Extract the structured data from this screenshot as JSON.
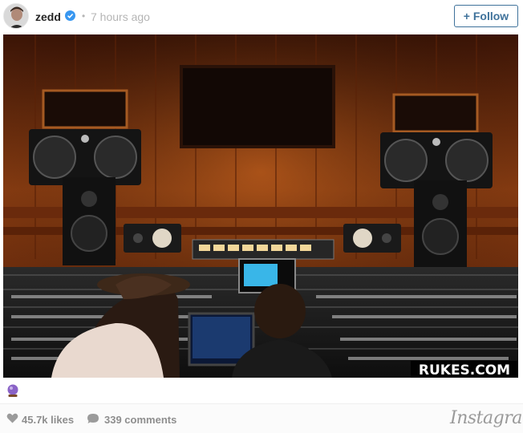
{
  "post": {
    "username": "zedd",
    "verified_icon": "verified-badge-icon",
    "separator": "•",
    "timestamp": "7 hours ago",
    "follow_label": "+ Follow",
    "photo_watermark": "RUKES.COM",
    "caption_icon": "crystal-ball-icon"
  },
  "footer": {
    "likes": "45.7k likes",
    "comments": "339 comments",
    "brand": "Instagram",
    "heart_icon": "heart-icon",
    "comment_icon": "comment-bubble-icon"
  },
  "colors": {
    "follow_blue": "#3f729b",
    "verified_blue": "#3897f0",
    "muted_gray": "#8e8e8e",
    "wood": "#8a3a12"
  }
}
